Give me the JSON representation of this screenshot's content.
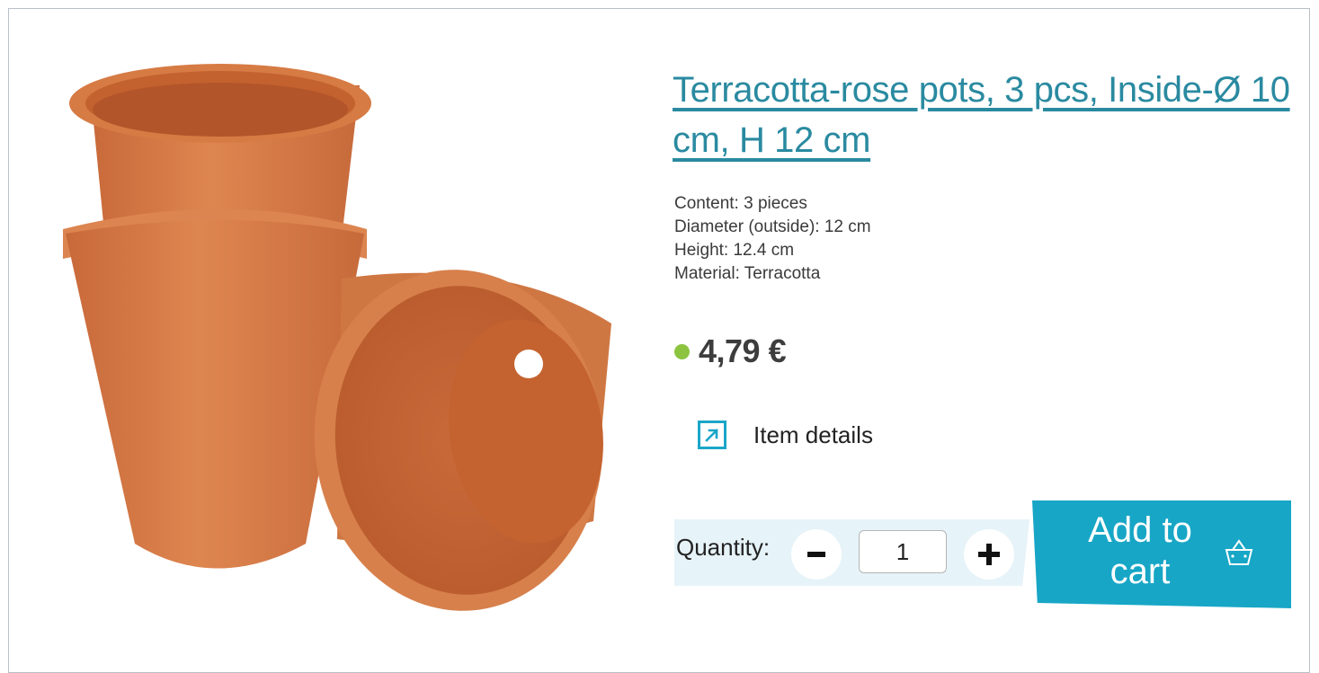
{
  "product": {
    "title": "Terracotta-rose pots, 3 pcs, Inside-Ø 10 cm, H 12 cm",
    "specs": [
      "Content: 3 pieces",
      "Diameter (outside): 12 cm",
      "Height: 12.4 cm",
      "Material: Terracotta"
    ],
    "price": "4,79 €",
    "availability_color": "#8cc43f"
  },
  "details_link": {
    "label": "Item details",
    "icon": "external-link-arrow-icon"
  },
  "quantity": {
    "label": "Quantity:",
    "value": "1",
    "decrease_icon": "minus-icon",
    "increase_icon": "plus-icon"
  },
  "cart_button": {
    "label": "Add to cart",
    "icon": "basket-icon"
  },
  "colors": {
    "accent": "#17a6c6",
    "title": "#2a8aa0",
    "quantity_band": "#e6f3f8",
    "terracotta": "#d27a45"
  }
}
